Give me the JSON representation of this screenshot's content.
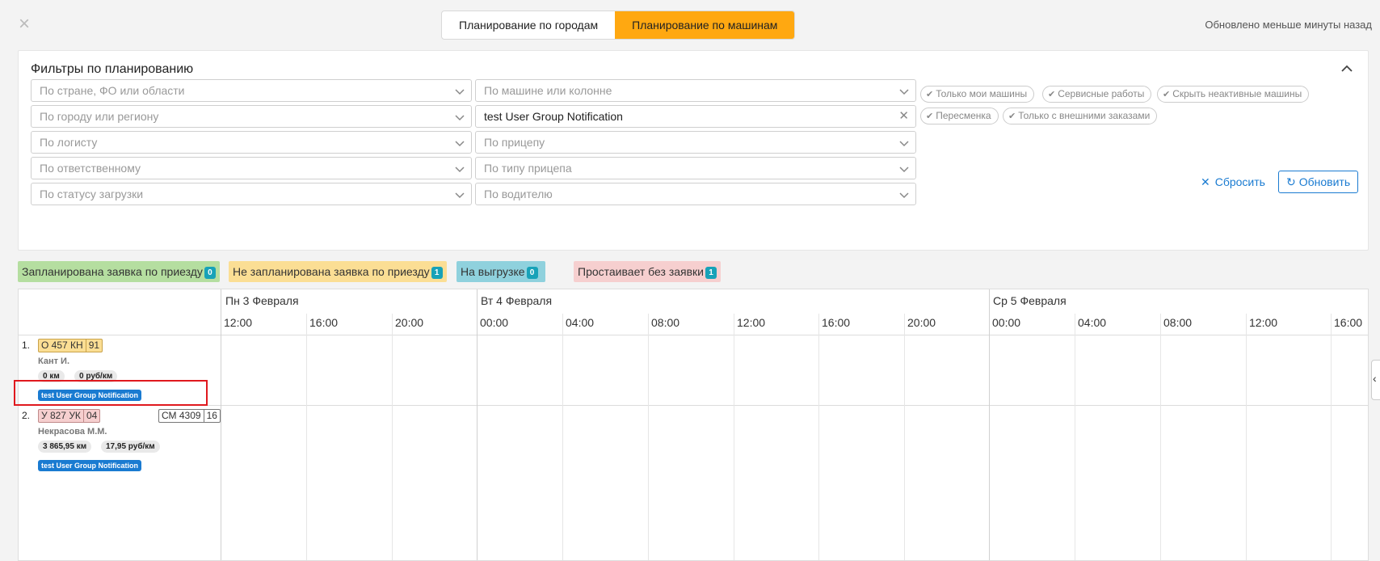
{
  "header": {
    "tabs": [
      {
        "label": "Планирование по городам",
        "active": false
      },
      {
        "label": "Планирование по машинам",
        "active": true
      }
    ],
    "updated": "Обновлено меньше минуты назад",
    "close_icon": "close-icon"
  },
  "filters": {
    "title": "Фильтры по планированию",
    "left": [
      {
        "placeholder": "По стране, ФО или области",
        "value": ""
      },
      {
        "placeholder": "По городу или региону",
        "value": ""
      },
      {
        "placeholder": "По логисту",
        "value": ""
      },
      {
        "placeholder": "По ответственному",
        "value": ""
      },
      {
        "placeholder": "По статусу загрузки",
        "value": ""
      }
    ],
    "right": [
      {
        "placeholder": "По машине или колонне",
        "value": ""
      },
      {
        "placeholder": "",
        "value": "test User Group Notification"
      },
      {
        "placeholder": "По прицепу",
        "value": ""
      },
      {
        "placeholder": "По типу прицепа",
        "value": ""
      },
      {
        "placeholder": "По водителю",
        "value": ""
      }
    ],
    "chips": [
      "Только мои машины",
      "Сервисные работы",
      "Скрыть неактивные машины",
      "Пересменка",
      "Только с внешними заказами"
    ],
    "reset_label": "Сбросить",
    "refresh_label": "Обновить"
  },
  "legend": [
    {
      "label": "Запланирована заявка по приезду",
      "count": "0",
      "color": "#b5dea0"
    },
    {
      "label": "Не запланирована заявка по приезду",
      "count": "1",
      "color": "#fbde94"
    },
    {
      "label": "На выгрузке",
      "count": "0",
      "color": "#8fd1dd"
    },
    {
      "label": "Простаивает без заявки",
      "count": "1",
      "color": "#f6cfcf"
    }
  ],
  "timeline": {
    "days": [
      "Пн 3 Февраля",
      "Вт 4 Февраля",
      "Ср 5 Февраля"
    ],
    "times": [
      "12:00",
      "16:00",
      "20:00",
      "00:00",
      "04:00",
      "08:00",
      "12:00",
      "16:00",
      "20:00",
      "00:00",
      "04:00",
      "08:00",
      "12:00",
      "16:00"
    ]
  },
  "vehicles": [
    {
      "num": "1.",
      "plate": "О 457 КН",
      "region": "91",
      "plate_color": "#fbde94",
      "driver": "Кант И.",
      "distance": "0 км",
      "rate": "0 руб/км",
      "group": "test User Group Notification",
      "trailer": "",
      "trailer_region": ""
    },
    {
      "num": "2.",
      "plate": "У 827 УК",
      "region": "04",
      "plate_color": "#f6cfcf",
      "driver": "Некрасова М.М.",
      "distance": "3 865,95 км",
      "rate": "17,95 руб/км",
      "group": "test User Group Notification",
      "trailer": "СМ 4309",
      "trailer_region": "16"
    }
  ]
}
